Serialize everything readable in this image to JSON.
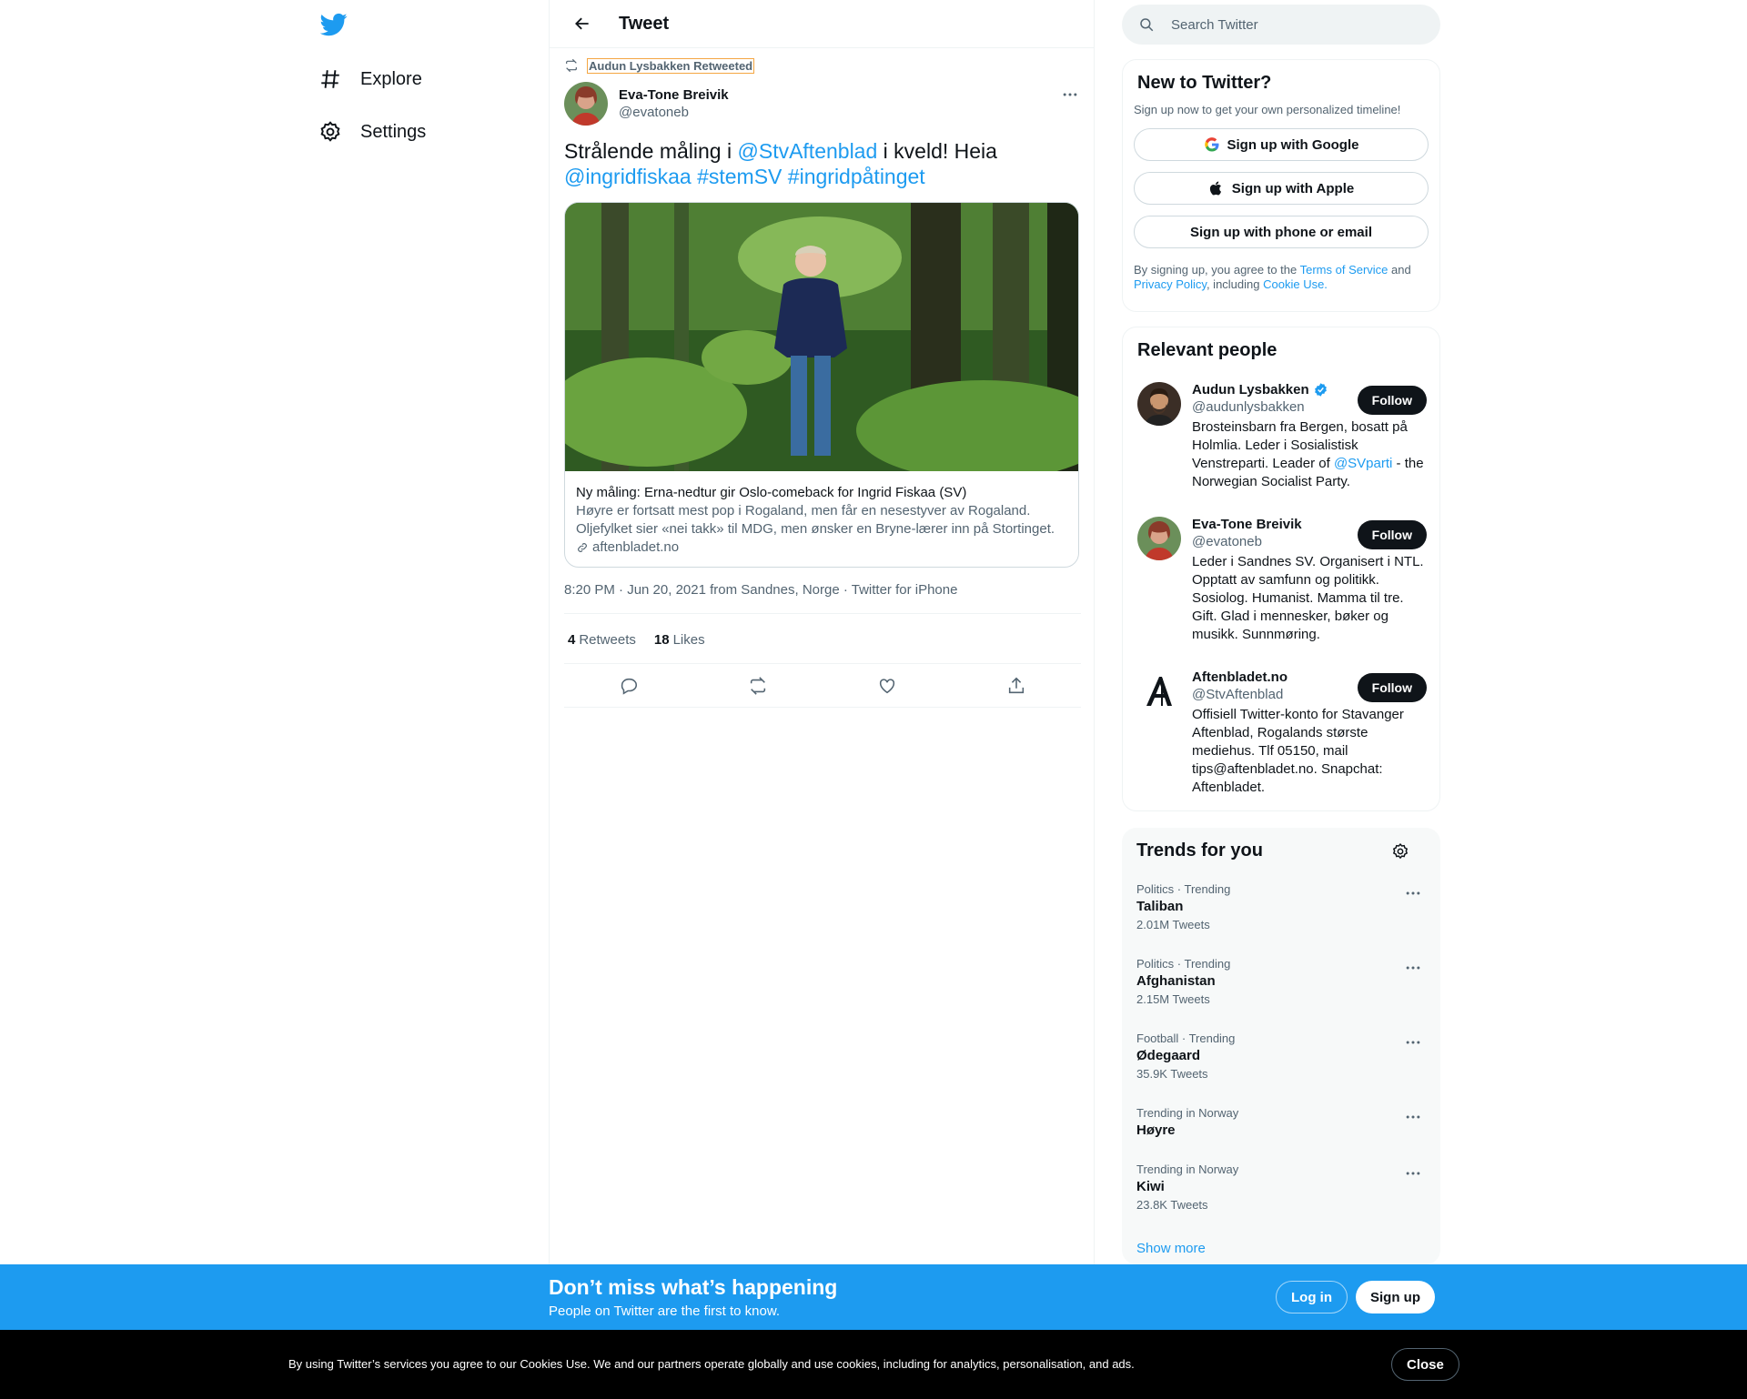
{
  "colors": {
    "accent": "#1d9bf0",
    "text": "#0f1419",
    "muted": "#536471",
    "cookie_bar": "#000000"
  },
  "nav": {
    "logo_icon": "twitter-bird-icon",
    "items": [
      {
        "label": "Explore",
        "icon": "hashtag-icon"
      },
      {
        "label": "Settings",
        "icon": "gear-icon"
      }
    ]
  },
  "header": {
    "back_icon": "arrow-left-icon",
    "title": "Tweet"
  },
  "tweet": {
    "retweeted_by": "Audun Lysbakken Retweeted",
    "author_name": "Eva-Tone Breivik",
    "author_handle": "@evatoneb",
    "text_parts": {
      "t1": "Strålende måling i ",
      "mention": "@StvAftenblad",
      "t2": " i kveld! Heia",
      "tag1": "@ingridfiskaa",
      "tag2": "#stemSV",
      "tag3": "#ingridpåtinget"
    },
    "card": {
      "title": "Ny måling: Erna-nedtur gir Oslo-comeback for Ingrid Fiskaa (SV)",
      "description": "Høyre er fortsatt mest pop i Rogaland, men får en nesestyver av Rogaland. Oljefylket sier «nei takk» til MDG, men ønsker en Bryne-lærer inn på Stortinget.",
      "domain": "aftenbladet.no"
    },
    "meta": "8:20 PM · Jun 20, 2021 from Sandnes, Norge · Twitter for iPhone",
    "retweets_count": "4",
    "retweets_label": "Retweets",
    "likes_count": "18",
    "likes_label": "Likes"
  },
  "search": {
    "placeholder": "Search Twitter"
  },
  "signup_box": {
    "title": "New to Twitter?",
    "subtitle": "Sign up now to get your own personalized timeline!",
    "google": "Sign up with Google",
    "apple": "Sign up with Apple",
    "phone": "Sign up with phone or email",
    "legal": {
      "p1": "By signing up, you agree to the ",
      "tos": "Terms of Service",
      "p2": " and ",
      "privacy": "Privacy Policy",
      "p3": ", including ",
      "cookie": "Cookie Use."
    }
  },
  "relevant": {
    "title": "Relevant people",
    "follow_label": "Follow",
    "people": [
      {
        "name": "Audun Lysbakken",
        "handle": "@audunlysbakken",
        "bio1": "Brosteinsbarn fra Bergen, bosatt på Holmlia. Leder i Sosialistisk Venstreparti. Leader of ",
        "bio_link": "@SVparti",
        "bio2": " - the Norwegian Socialist Party."
      },
      {
        "name": "Eva-Tone Breivik",
        "handle": "@evatoneb",
        "bio1": "Leder i Sandnes SV. Organisert i NTL. Opptatt av samfunn og politikk. Sosiolog. Humanist. Mamma til tre. Gift. Glad i mennesker, bøker og musikk. Sunnmøring."
      },
      {
        "name": "Aftenbladet.no",
        "handle": "@StvAftenblad",
        "bio1": "Offisiell Twitter-konto for Stavanger Aftenblad, Rogalands største mediehus. Tlf 05150, mail tips@aftenbladet.no. Snapchat: Aftenbladet."
      }
    ]
  },
  "trends": {
    "title": "Trends for you",
    "items": [
      {
        "context": "Politics · Trending",
        "name": "Taliban",
        "count": "2.01M Tweets"
      },
      {
        "context": "Politics · Trending",
        "name": "Afghanistan",
        "count": "2.15M Tweets"
      },
      {
        "context": "Football · Trending",
        "name": "Ødegaard",
        "count": "35.9K Tweets"
      },
      {
        "context": "Trending in Norway",
        "name": "Høyre"
      },
      {
        "context": "Trending in Norway",
        "name": "Kiwi",
        "count": "23.8K Tweets"
      }
    ],
    "show_more": "Show more"
  },
  "signup_bar": {
    "headline": "Don’t miss what’s happening",
    "sub": "People on Twitter are the first to know.",
    "login": "Log in",
    "signup": "Sign up"
  },
  "cookie_bar": {
    "text": "By using Twitter’s services you agree to our Cookies Use. We and our partners operate globally and use cookies, including for analytics, personalisation, and ads.",
    "close": "Close"
  }
}
